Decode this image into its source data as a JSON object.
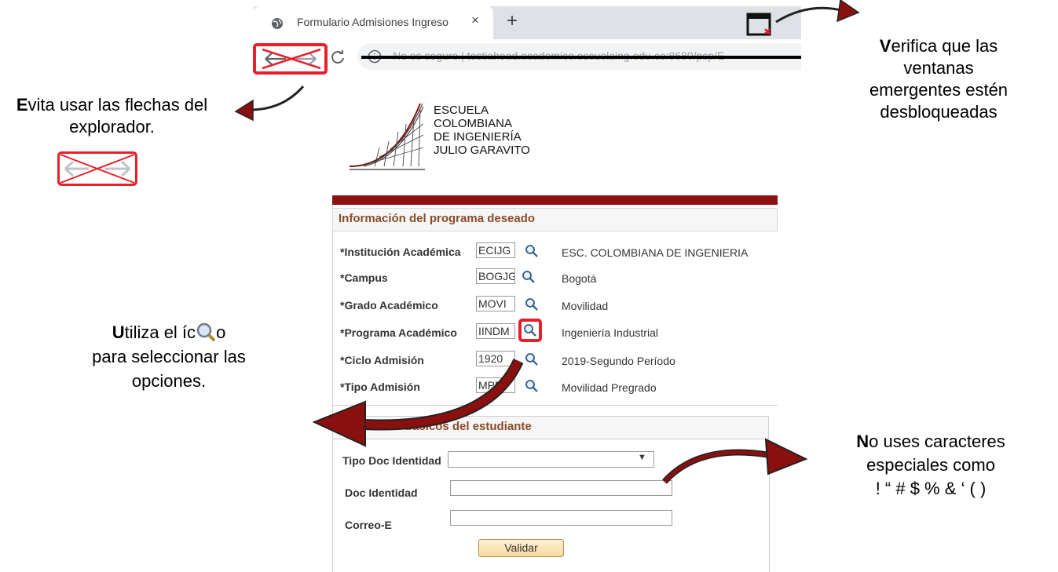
{
  "browser": {
    "tab_title": "Formulario Admisiones Ingreso",
    "tab_close": "×",
    "new_tab": "+",
    "url": "No es seguro | testiahead.academico.escuelaing.edu.co:8680/psp/E"
  },
  "logo": {
    "line1": "ESCUELA",
    "line2": "COLOMBIANA",
    "line3": "DE INGENIERÍA",
    "line4": "JULIO GARAVITO"
  },
  "callouts": {
    "arrows": {
      "bold": "E",
      "rest": "vita usar las flechas del explorador."
    },
    "popups": {
      "bold": "V",
      "rest": "erifica que las ventanas emergentes estén desbloqueadas"
    },
    "lookup": {
      "bold": "U",
      "rest_a": "tiliza el íc",
      "rest_b": "o",
      "rest_c": "para seleccionar las opciones."
    },
    "special": {
      "bold": "N",
      "rest": "o uses caracteres especiales como",
      "chars": "! “ # $ % & ‘ ( )"
    }
  },
  "form": {
    "section1_title": "Información del programa deseado",
    "fields": [
      {
        "label": "*Institución Académica",
        "code": "ECIJG",
        "description": "ESC. COLOMBIANA DE INGENIERIA"
      },
      {
        "label": "*Campus",
        "code": "BOGJG",
        "description": "Bogotá"
      },
      {
        "label": "*Grado Académico",
        "code": "MOVI",
        "description": "Movilidad"
      },
      {
        "label": "*Programa Académico",
        "code": "IINDM",
        "description": "Ingeniería Industrial"
      },
      {
        "label": "*Ciclo Admisión",
        "code": "1920",
        "description": "2019-Segundo Período"
      },
      {
        "label": "*Tipo Admisión",
        "code": "MPR",
        "description": "Movilidad Pregrado"
      }
    ],
    "section2_title": "Datos básicos del estudiante",
    "tipo_doc_label": "Tipo Doc Identidad",
    "doc_label": "Doc Identidad",
    "correo_label": "Correo-E",
    "validar_label": "Validar"
  },
  "colors": {
    "accent_red": "#e8202a",
    "maroon": "#8e1010",
    "section_title": "#8b4a28"
  },
  "icons": [
    "globe-icon",
    "back-arrow-icon",
    "forward-arrow-icon",
    "reload-icon",
    "popup-blocked-icon",
    "search-icon",
    "curved-arrow-icon"
  ]
}
